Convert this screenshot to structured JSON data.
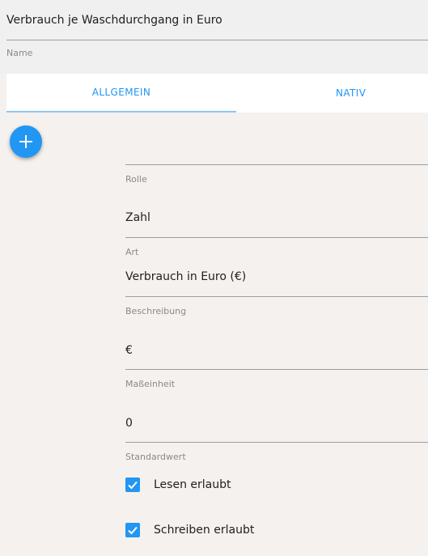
{
  "header": {
    "name_value": "Verbrauch je Waschdurchgang in Euro",
    "name_label": "Name"
  },
  "tabs": [
    {
      "label": "ALLGEMEIN",
      "active": true
    },
    {
      "label": "NATIV",
      "active": false
    }
  ],
  "fab": {
    "icon": "plus-icon"
  },
  "fields": {
    "role": {
      "label": "Rolle",
      "value": "Zahl"
    },
    "type": {
      "label": "Art",
      "value": "Verbrauch in Euro (€)"
    },
    "description": {
      "label": "Beschreibung",
      "value": "€"
    },
    "unit": {
      "label": "Maßeinheit",
      "value": "0"
    },
    "default": {
      "label": "Standardwert"
    }
  },
  "checkboxes": [
    {
      "label": "Lesen erlaubt",
      "checked": true
    },
    {
      "label": "Schreiben erlaubt",
      "checked": true
    }
  ],
  "colors": {
    "accent": "#2196f3",
    "background": "#f5f1ee",
    "header_bg": "#f0f0f0"
  }
}
